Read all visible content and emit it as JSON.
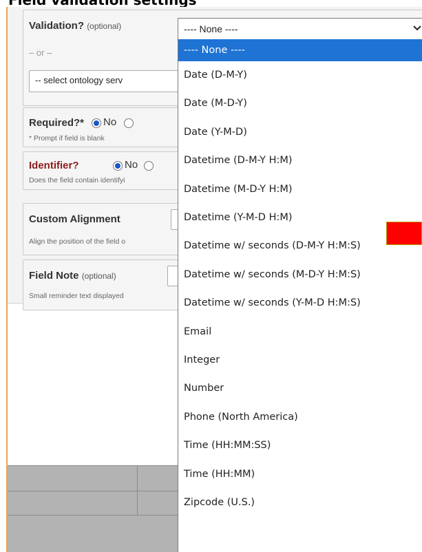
{
  "header": {
    "title_fragment": "Field validation settings"
  },
  "validation": {
    "label": "Validation?",
    "optional": "(optional)",
    "or_text": "– or –",
    "ontology_placeholder": "-- select ontology serv",
    "selected_value": "---- None ----",
    "chevron": "chevron-down-icon",
    "options": [
      "---- None ----",
      "Date (D-M-Y)",
      "Date (M-D-Y)",
      "Date (Y-M-D)",
      "Datetime (D-M-Y H:M)",
      "Datetime (M-D-Y H:M)",
      "Datetime (Y-M-D H:M)",
      "Datetime w/ seconds (D-M-Y H:M:S)",
      "Datetime w/ seconds (M-D-Y H:M:S)",
      "Datetime w/ seconds (Y-M-D H:M:S)",
      "Email",
      "Integer",
      "Number",
      "Phone (North America)",
      "Time (HH:MM:SS)",
      "Time (HH:MM)",
      "Zipcode (U.S.)"
    ]
  },
  "required": {
    "label": "Required?*",
    "no_label": "No",
    "hint": "* Prompt if field is blank"
  },
  "identifier": {
    "label": "Identifier?",
    "no_label": "No",
    "hint": "Does the field contain identifyi"
  },
  "custom_alignment": {
    "label": "Custom Alignment",
    "hint": "Align the position of the field o"
  },
  "field_note": {
    "label": "Field Note",
    "optional": "(optional)",
    "hint": "Small reminder text displayed"
  },
  "colors": {
    "selected": "#1e73d4",
    "marker": "#ff0000",
    "identifier_label": "#8b1a1a",
    "panel_border": "#e8a35a"
  }
}
